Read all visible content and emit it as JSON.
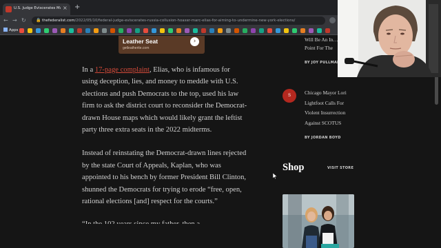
{
  "browser": {
    "tab_title": "U.S. Judge Eviscerates Marc Elias...",
    "new_tab_glyph": "+",
    "url_domain": "thefederalist.com",
    "url_path": "/2022/05/10/federal-judge-eviscerates-russia-collusion-hoaxer-marc-elias-for-aiming-to-undermine-new-york-elections/",
    "bookmarks_apps_label": "Apps"
  },
  "ad": {
    "title": "Leather Seat",
    "domain": "getleatherite.com"
  },
  "article": {
    "p1_prefix": "In a ",
    "p1_link": "17-page complaint",
    "p1_rest": ", Elias, who is infamous for using deception, lies, and money to meddle with U.S. elections and push Democrats to the top, used his law firm to ask the district court to reconsider the Democrat-drawn House maps which would likely grant the leftist party three extra seats in the 2022 midterms.",
    "p2": "Instead of reinstating the Democrat-drawn lines rejected by the state Court of Appeals, Kaplan, who was appointed to his bench by former President Bill Clinton, shunned the Democrats for trying to erode “free, open, rational elections [and] respect for the courts.”",
    "p3_partial": "“In the 102 years since my father, then a"
  },
  "sidebar": {
    "story1_title_tail": "Will Be An In… Point For The",
    "story1_author": "BY JOY PULLMANN",
    "story2_badge": "S",
    "story2_title": "Chicago Mayor Lori Lightfoot Calls For Violent Insurrection Against SCOTUS",
    "story2_author": "BY JORDAN BOYD",
    "shop_heading": "Shop",
    "shop_link": "VISIT STORE"
  },
  "colors": {
    "page_bg": "#151515",
    "link": "#d64b3a",
    "badge": "#b3281f",
    "ad_bg": "#5a3a26"
  }
}
